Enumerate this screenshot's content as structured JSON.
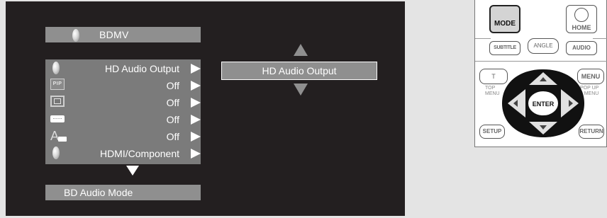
{
  "osd": {
    "top_bar": {
      "label": "BDMV"
    },
    "menu_rows": [
      {
        "label": "HD Audio Output",
        "icon": "disc-icon"
      },
      {
        "label": "Off",
        "icon": "pip-icon"
      },
      {
        "label": "Off",
        "icon": "secondary-audio-icon"
      },
      {
        "label": "Off",
        "icon": "subtitle-icon"
      },
      {
        "label": "Off",
        "icon": "angle-icon"
      },
      {
        "label": "HDMI/Component",
        "icon": "disc-icon"
      }
    ],
    "pip_icon_text": "PIP",
    "subtitle_icon_text": "......",
    "angle_icon_text": "A",
    "bottom_bar": {
      "label": "BD Audio Mode"
    },
    "output_box": {
      "label": "HD Audio Output"
    }
  },
  "remote": {
    "mode": "MODE",
    "home": "HOME",
    "subtitle": "SUBTITLE",
    "angle": "ANGLE",
    "audio": "AUDIO",
    "t": "T",
    "top_menu": "TOP\nMENU",
    "menu": "MENU",
    "popup_menu": "POP UP\nMENU",
    "enter": "ENTER",
    "setup": "SETUP",
    "return": "RETURN"
  },
  "colors": {
    "screen_bg": "#231f20",
    "bar_gray": "#8f8f8f",
    "panel_gray": "#7b7b7b",
    "page_bg": "#e4e4e4"
  }
}
